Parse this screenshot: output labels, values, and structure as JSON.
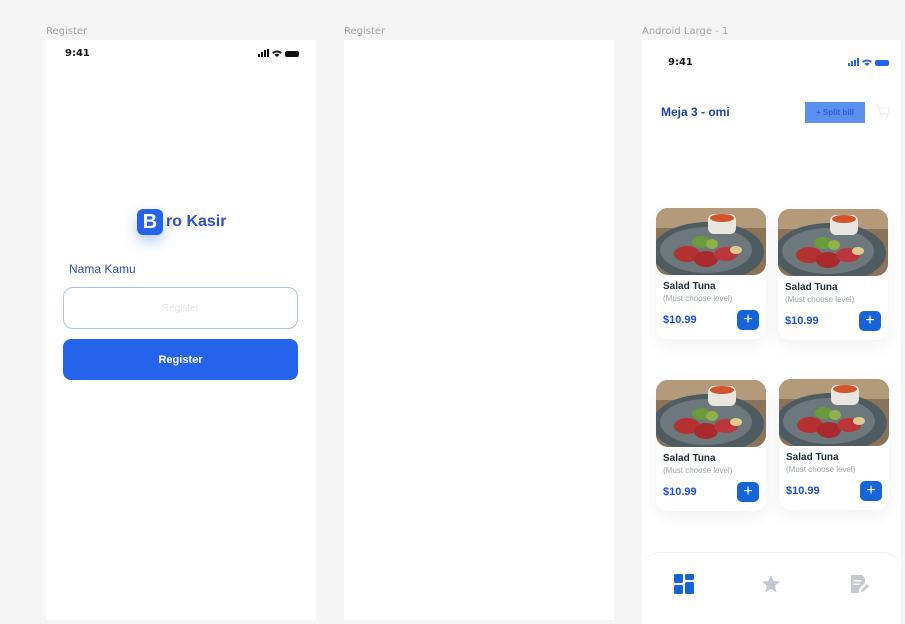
{
  "frames": [
    {
      "label": "Register"
    },
    {
      "label": "Register"
    },
    {
      "label": "Android Large - 1"
    }
  ],
  "register": {
    "status_time": "9:41",
    "logo_letter": "B",
    "logo_text": "ro Kasir",
    "field_label": "Nama Kamu",
    "input_placeholder": "Register",
    "button_label": "Register"
  },
  "menu": {
    "status_time": "9:41",
    "title": "Meja 3 - omi",
    "split_bill_label": "+ Split bill",
    "items": [
      {
        "name": "Salad Tuna",
        "subtitle": "(Must choose level)",
        "price": "$10.99"
      },
      {
        "name": "Salad Tuna",
        "subtitle": "(Must choose level)",
        "price": "$10.99"
      },
      {
        "name": "Salad Tuna",
        "subtitle": "(Must choose level)",
        "price": "$10.99"
      },
      {
        "name": "Salad Tuna",
        "subtitle": "(Must choose level)",
        "price": "$10.99"
      }
    ],
    "add_symbol": "+",
    "nav": [
      {
        "icon": "grid-icon",
        "active": true
      },
      {
        "icon": "star-icon",
        "active": false
      },
      {
        "icon": "edit-note-icon",
        "active": false
      }
    ]
  },
  "colors": {
    "primary": "#2563eb",
    "title": "#1e40af",
    "nav_inactive": "#c4c8d0"
  }
}
